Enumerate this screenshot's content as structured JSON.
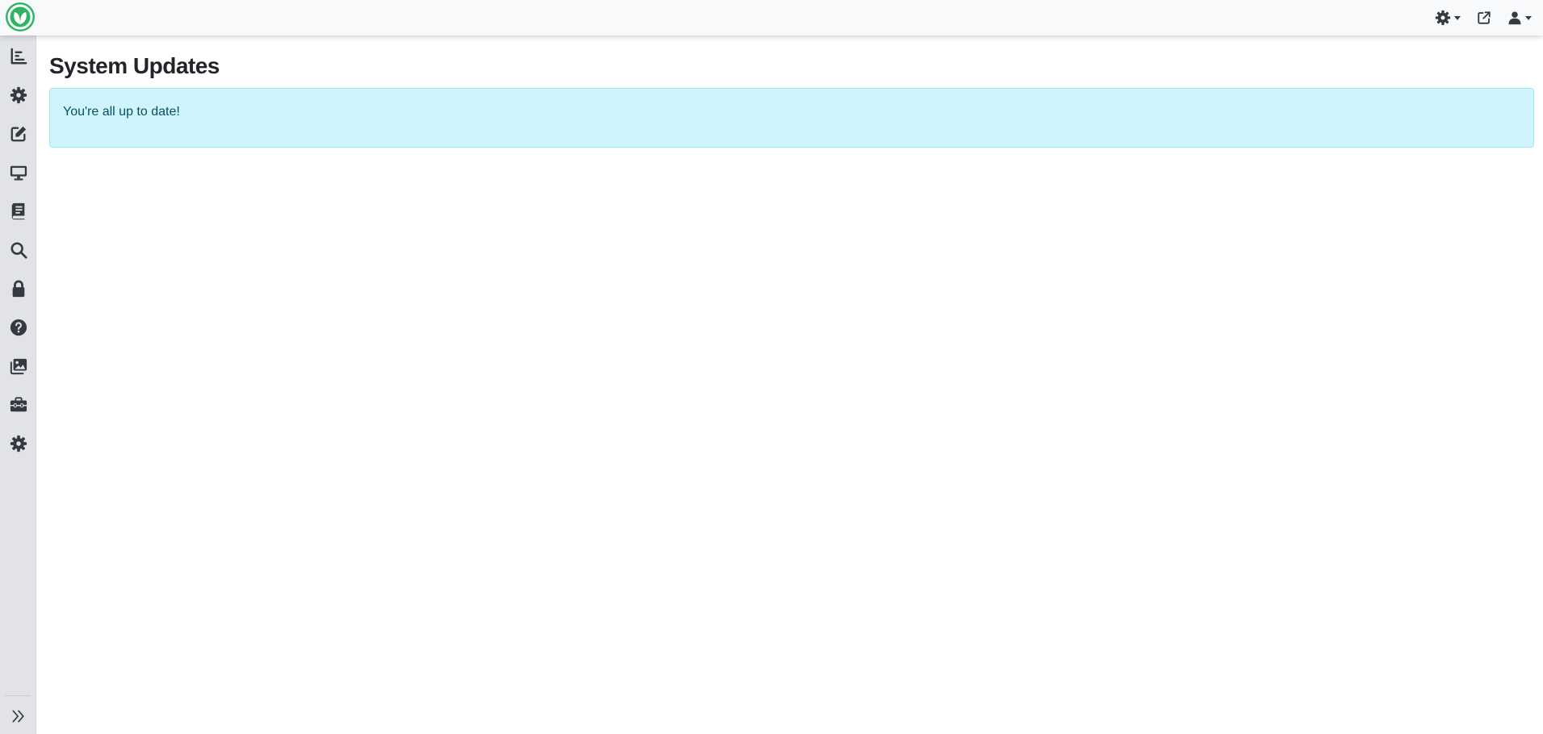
{
  "header": {
    "logo_label": "",
    "icons": [
      "gear-icon",
      "external-link-icon",
      "user-icon"
    ]
  },
  "sidebar": {
    "items": [
      {
        "name": "sidebar-item-reports",
        "icon": "chart-list-icon"
      },
      {
        "name": "sidebar-item-settings",
        "icon": "gear-icon"
      },
      {
        "name": "sidebar-item-content",
        "icon": "edit-icon"
      },
      {
        "name": "sidebar-item-display",
        "icon": "monitor-icon"
      },
      {
        "name": "sidebar-item-library",
        "icon": "book-icon"
      },
      {
        "name": "sidebar-item-search",
        "icon": "search-icon"
      },
      {
        "name": "sidebar-item-security",
        "icon": "lock-icon"
      },
      {
        "name": "sidebar-item-help",
        "icon": "question-icon"
      },
      {
        "name": "sidebar-item-media",
        "icon": "images-icon"
      },
      {
        "name": "sidebar-item-tools",
        "icon": "toolbox-icon"
      },
      {
        "name": "sidebar-item-system",
        "icon": "gear-icon"
      }
    ],
    "toggle_icon": "expand-icon"
  },
  "main": {
    "title": "System Updates",
    "alert_text": "You're all up to date!"
  },
  "colors": {
    "brand": "#2fb463",
    "alert_bg": "#cff4fc",
    "alert_border": "#9eeaf9",
    "alert_text": "#055160"
  }
}
